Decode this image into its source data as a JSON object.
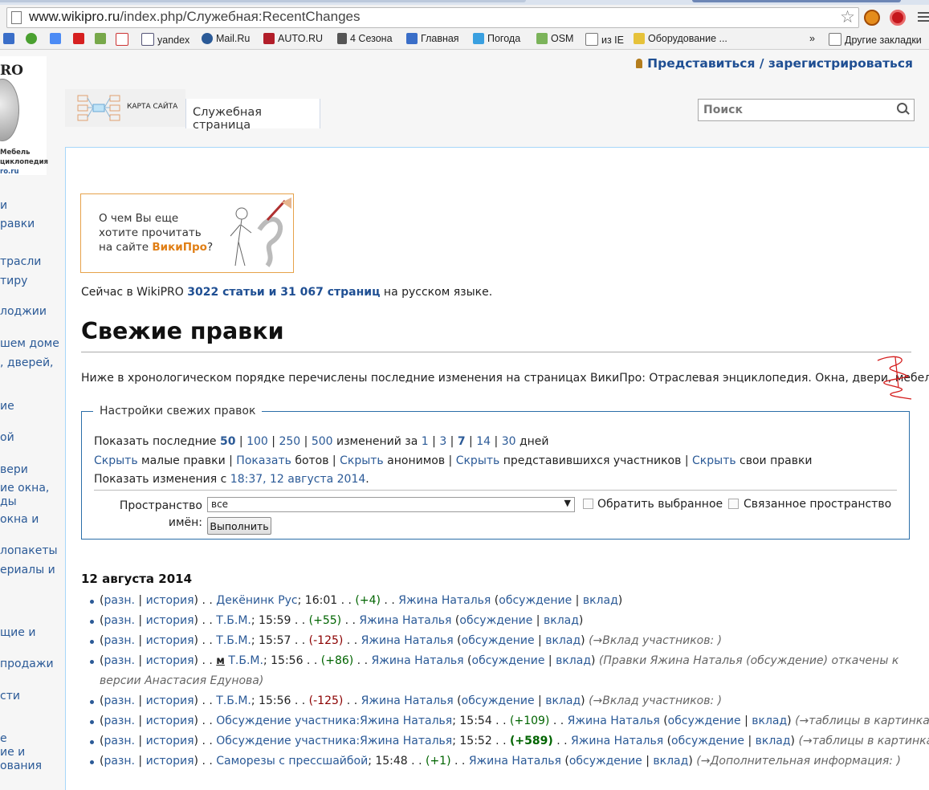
{
  "browser": {
    "url_host": "www.wikipro.ru",
    "url_path": "/index.php/Служебная:RecentChanges",
    "bookmarks": [
      "yandex",
      "Mail.Ru",
      "AUTO.RU",
      "4 Сезона",
      "Главная",
      "Погода",
      "OSM",
      "из IE",
      "Оборудование ...",
      "»",
      "Другие закладки"
    ]
  },
  "logo": {
    "text": "RO",
    "sub_line1": "Мебель",
    "sub_line2": "циклопедия",
    "sub_line3": "ro.ru"
  },
  "left_nav": [
    "и",
    "равки",
    "трасли",
    "тиру",
    "лоджии",
    "шем доме",
    ", дверей,",
    "ие",
    "ой",
    "вери",
    "ие окна,",
    "ды",
    "окна и",
    "лопакеты",
    "ериалы и",
    "щие и",
    "продажи",
    "сти",
    "е",
    "ие и",
    "ования"
  ],
  "personal": {
    "login": "Представиться / зарегистрироваться"
  },
  "tabs": {
    "sitemap": "КАРТА САЙТА",
    "special": "Служебная страница"
  },
  "search": {
    "placeholder": "Поиск"
  },
  "banner": {
    "line1": "О чем Вы еще",
    "line2": "хотите прочитать",
    "line3_pre": "на сайте ",
    "line3_brand": "ВикиПро",
    "line3_post": "?"
  },
  "stats": {
    "pre": "Сейчас в WikiPRO ",
    "link": "3022 статьи и 31 067 страниц",
    "post": " на русском языке."
  },
  "heading": "Свежие правки",
  "intro": "Ниже в хронологическом порядке перечислены последние изменения на страницах ВикиПро: Отраслевая энциклопедия. Окна, двери, мебель.",
  "options": {
    "legend": "Настройки свежих правок",
    "show_last": "Показать последние",
    "limits": [
      "50",
      "100",
      "250",
      "500"
    ],
    "changes_for": "изменений за",
    "days": [
      "1",
      "3",
      "7",
      "14",
      "30"
    ],
    "days_word": "дней",
    "hide": "Скрыть",
    "show": "Показать",
    "minor": "малые правки",
    "bots": "ботов",
    "anons": "анонимов",
    "logged": "представившихся участников",
    "mine": "свои правки",
    "since_pre": "Показать изменения с",
    "since_link": "18:37, 12 августа 2014",
    "namespace_label": "Пространство имён:",
    "namespace_value": "все",
    "invert": "Обратить выбранное",
    "associated": "Связанное пространство",
    "go": "Выполнить"
  },
  "date_heading": "12 августа 2014",
  "changes": [
    {
      "diff": "разн.",
      "hist": "история",
      "title": "Декёнинк Рус",
      "time": "16:01",
      "size": "(+4)",
      "user": "Яжина Наталья",
      "talk": "обсуждение",
      "contribs": "вклад",
      "comment": ""
    },
    {
      "diff": "разн.",
      "hist": "история",
      "title": "Т.Б.М.",
      "time": "15:59",
      "size": "(+55)",
      "user": "Яжина Наталья",
      "talk": "обсуждение",
      "contribs": "вклад",
      "comment": ""
    },
    {
      "diff": "разн.",
      "hist": "история",
      "title": "Т.Б.М.",
      "time": "15:57",
      "size": "(-125)",
      "user": "Яжина Наталья",
      "talk": "обсуждение",
      "contribs": "вклад",
      "comment": "(→Вклад участников: )"
    },
    {
      "diff": "разн.",
      "hist": "история",
      "minor": "м",
      "title": "Т.Б.М.",
      "time": "15:56",
      "size": "(+86)",
      "user": "Яжина Наталья",
      "talk": "обсуждение",
      "contribs": "вклад",
      "comment_pre": "(Правки ",
      "comment_user": "Яжина Наталья",
      "comment_paren_open": " (",
      "comment_talk": "обсуждение",
      "comment_mid": ") откачены к версии ",
      "comment_target": "Анастасия Едунова",
      "comment_end": ")"
    },
    {
      "diff": "разн.",
      "hist": "история",
      "title": "Т.Б.М.",
      "time": "15:56",
      "size": "(-125)",
      "user": "Яжина Наталья",
      "talk": "обсуждение",
      "contribs": "вклад",
      "comment": "(→Вклад участников: )"
    },
    {
      "diff": "разн.",
      "hist": "история",
      "title": "Обсуждение участника:Яжина Наталья",
      "time": "15:54",
      "size": "(+109)",
      "user": "Яжина Наталья",
      "talk": "обсуждение",
      "contribs": "вклад",
      "comment": "(→таблицы в картинках: )"
    },
    {
      "diff": "разн.",
      "hist": "история",
      "title": "Обсуждение участника:Яжина Наталья",
      "time": "15:52",
      "size": "(+589)",
      "user": "Яжина Наталья",
      "talk": "обсуждение",
      "contribs": "вклад",
      "comment": "(→таблицы в картинках: )"
    },
    {
      "diff": "разн.",
      "hist": "история",
      "title": "Саморезы с прессшайбой",
      "time": "15:48",
      "size": "(+1)",
      "user": "Яжина Наталья",
      "talk": "обсуждение",
      "contribs": "вклад",
      "comment": "(→Дополнительная информация: )"
    }
  ]
}
